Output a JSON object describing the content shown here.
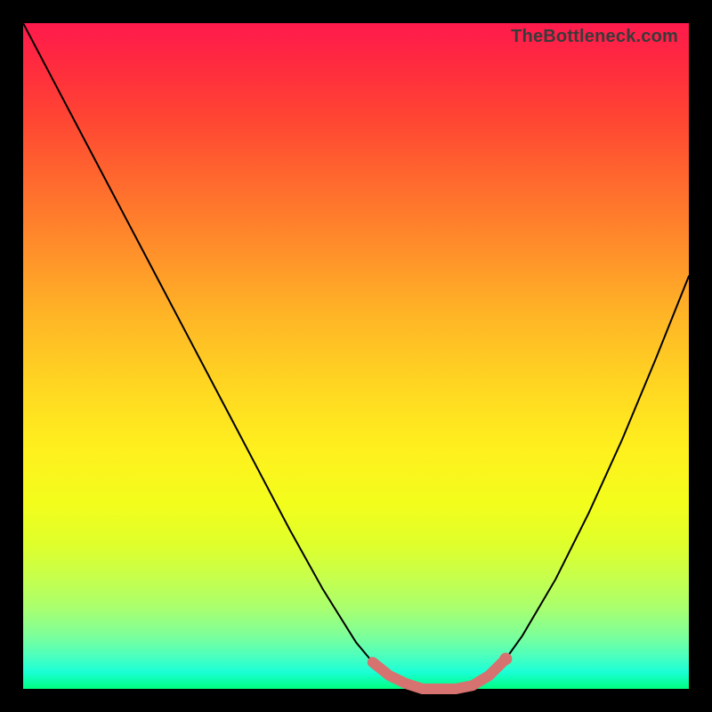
{
  "watermark": "TheBottleneck.com",
  "chart_data": {
    "type": "line",
    "title": "",
    "xlabel": "",
    "ylabel": "",
    "xlim": [
      0,
      1
    ],
    "ylim": [
      0,
      1
    ],
    "series": [
      {
        "name": "curve",
        "x": [
          0.0,
          0.05,
          0.1,
          0.15,
          0.2,
          0.25,
          0.3,
          0.35,
          0.4,
          0.45,
          0.5,
          0.525,
          0.55,
          0.575,
          0.6,
          0.625,
          0.65,
          0.675,
          0.7,
          0.725,
          0.75,
          0.8,
          0.85,
          0.9,
          0.95,
          1.0
        ],
        "y": [
          1.0,
          0.905,
          0.81,
          0.715,
          0.62,
          0.525,
          0.43,
          0.335,
          0.24,
          0.15,
          0.07,
          0.04,
          0.02,
          0.008,
          0.0,
          0.0,
          0.0,
          0.005,
          0.02,
          0.045,
          0.08,
          0.165,
          0.265,
          0.375,
          0.495,
          0.62
        ]
      },
      {
        "name": "highlight-segment",
        "x": [
          0.525,
          0.55,
          0.575,
          0.6,
          0.625,
          0.65,
          0.675,
          0.7,
          0.725
        ],
        "y": [
          0.04,
          0.02,
          0.008,
          0.0,
          0.0,
          0.0,
          0.005,
          0.02,
          0.045
        ]
      }
    ],
    "colors": {
      "curve": "#000000",
      "highlight": "#d6726f",
      "gradient_top": "#ff1a4d",
      "gradient_bottom": "#00ff80"
    }
  }
}
